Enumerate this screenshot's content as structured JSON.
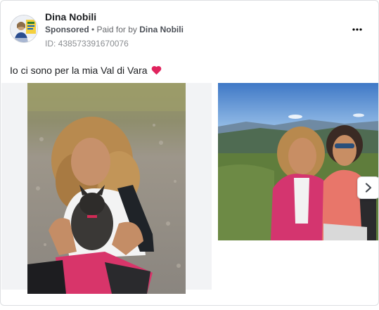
{
  "post": {
    "author": "Dina Nobili",
    "sponsored_label": "Sponsored",
    "separator": " • ",
    "paid_for_prefix": "Paid for by ",
    "paid_for_name": "Dina Nobili",
    "ad_id": "ID: 438573391670076",
    "caption": "Io ci sono per la mia Val di Vara",
    "caption_emoji": "heart-icon"
  },
  "icons": {
    "more": "more-horizontal-icon",
    "next": "chevron-right-icon"
  },
  "colors": {
    "heart": "#e0245e",
    "text_primary": "#1c1e21",
    "text_secondary": "#65676b",
    "border": "#dddfe2"
  }
}
